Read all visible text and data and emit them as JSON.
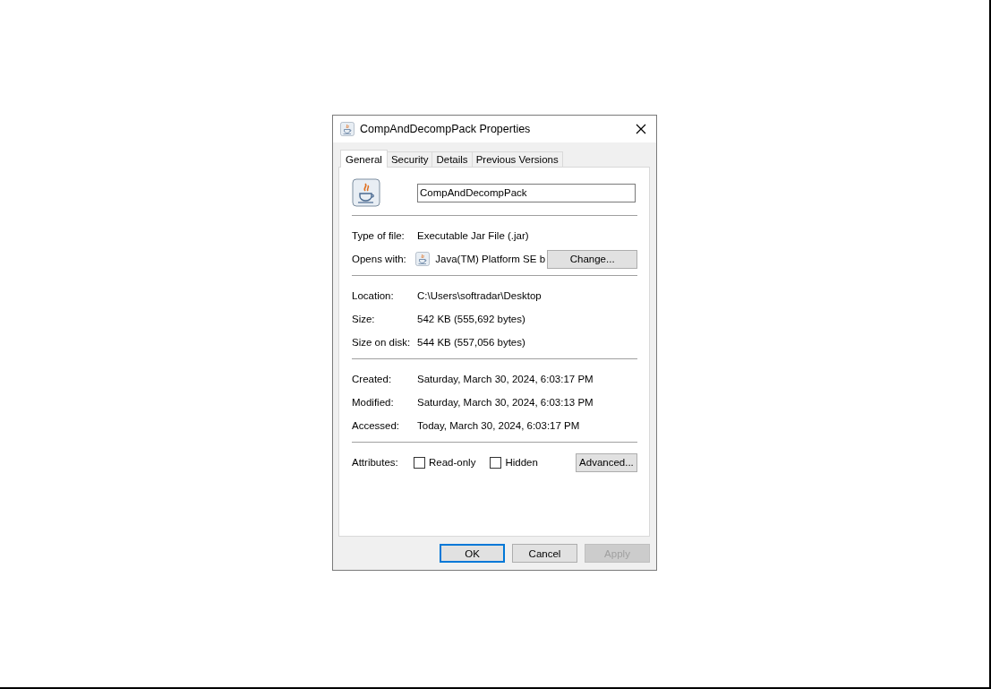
{
  "window": {
    "title": "CompAndDecompPack Properties"
  },
  "tabs": [
    {
      "label": "General",
      "selected": true
    },
    {
      "label": "Security",
      "selected": false
    },
    {
      "label": "Details",
      "selected": false
    },
    {
      "label": "Previous Versions",
      "selected": false
    }
  ],
  "file_name": {
    "value": "CompAndDecompPack"
  },
  "sections": [
    {
      "rows": [
        {
          "kind": "text",
          "label": "Type of file:",
          "value": "Executable Jar File (.jar)"
        },
        {
          "kind": "app",
          "label": "Opens with:",
          "value": "Java(TM) Platform SE b",
          "button": "Change..."
        }
      ]
    },
    {
      "rows": [
        {
          "kind": "text",
          "label": "Location:",
          "value": "C:\\Users\\softradar\\Desktop"
        },
        {
          "kind": "text",
          "label": "Size:",
          "value": "542 KB (555,692 bytes)"
        },
        {
          "kind": "text",
          "label": "Size on disk:",
          "value": "544 KB (557,056 bytes)"
        }
      ]
    },
    {
      "rows": [
        {
          "kind": "text",
          "label": "Created:",
          "value": "Saturday, March 30, 2024, 6:03:17 PM"
        },
        {
          "kind": "text",
          "label": "Modified:",
          "value": "Saturday, March 30, 2024, 6:03:13 PM"
        },
        {
          "kind": "text",
          "label": "Accessed:",
          "value": "Today, March 30, 2024, 6:03:17 PM"
        }
      ]
    },
    {
      "rows": [
        {
          "kind": "attributes",
          "label": "Attributes:",
          "checkboxes": [
            {
              "label": "Read-only",
              "checked": false
            },
            {
              "label": "Hidden",
              "checked": false
            }
          ],
          "button": "Advanced..."
        }
      ]
    }
  ],
  "buttons": [
    {
      "label": "OK",
      "default": true,
      "disabled": false
    },
    {
      "label": "Cancel",
      "default": false,
      "disabled": false
    },
    {
      "label": "Apply",
      "default": false,
      "disabled": true
    }
  ]
}
